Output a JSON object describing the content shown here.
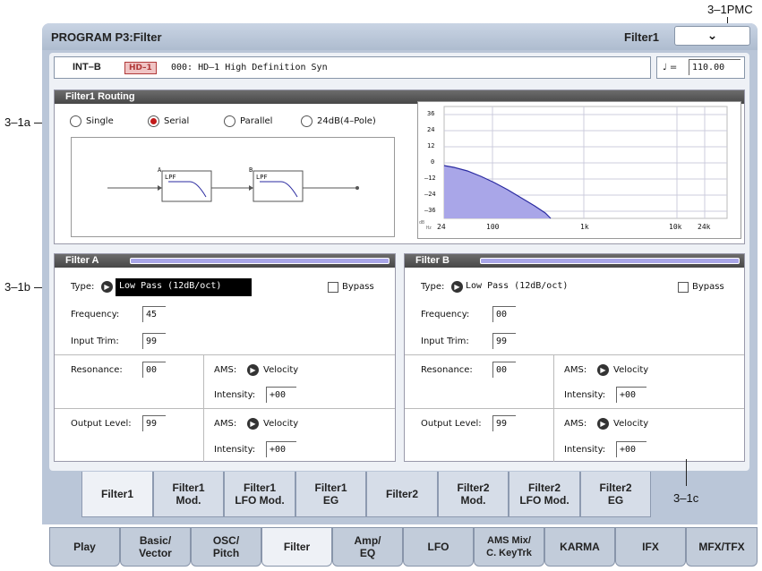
{
  "callouts": {
    "pmc": "3–1PMC",
    "a": "3–1a",
    "b": "3–1b",
    "c": "3–1c"
  },
  "header": {
    "title": "PROGRAM P3:Filter",
    "page_label": "Filter1",
    "menu_icon": "chevron-down"
  },
  "program": {
    "bank": "INT–B",
    "badge": "HD–1",
    "name": "000: HD–1 High Definition Syn"
  },
  "tempo": {
    "symbol": "♩ =",
    "value": "110.00"
  },
  "routing": {
    "title": "Filter1 Routing",
    "options": [
      "Single",
      "Serial",
      "Parallel",
      "24dB(4–Pole)"
    ],
    "selected": "Serial",
    "diagram": {
      "a_label": "A",
      "b_label": "B",
      "a_type": "LPF",
      "b_type": "LPF"
    }
  },
  "graph": {
    "y_ticks": [
      "36",
      "24",
      "12",
      "0",
      "–12",
      "–24",
      "–36"
    ],
    "x_ticks": [
      "24",
      "100",
      "1k",
      "10k",
      "24k"
    ],
    "unit_db": "dB",
    "unit_hz": "Hz"
  },
  "filter_a": {
    "title": "Filter A",
    "type_label": "Type:",
    "type_value": "Low Pass   (12dB/oct)",
    "bypass": "Bypass",
    "frequency_label": "Frequency:",
    "frequency": "45",
    "input_trim_label": "Input Trim:",
    "input_trim": "99",
    "resonance_label": "Resonance:",
    "resonance": "00",
    "ams1_label": "AMS:",
    "ams1": "Velocity",
    "int1_label": "Intensity:",
    "int1": "+00",
    "output_label": "Output Level:",
    "output": "99",
    "ams2_label": "AMS:",
    "ams2": "Velocity",
    "int2_label": "Intensity:",
    "int2": "+00"
  },
  "filter_b": {
    "title": "Filter B",
    "type_label": "Type:",
    "type_value": "Low Pass   (12dB/oct)",
    "bypass": "Bypass",
    "frequency_label": "Frequency:",
    "frequency": "00",
    "input_trim_label": "Input Trim:",
    "input_trim": "99",
    "resonance_label": "Resonance:",
    "resonance": "00",
    "ams1_label": "AMS:",
    "ams1": "Velocity",
    "int1_label": "Intensity:",
    "int1": "+00",
    "output_label": "Output Level:",
    "output": "99",
    "ams2_label": "AMS:",
    "ams2": "Velocity",
    "int2_label": "Intensity:",
    "int2": "+00"
  },
  "subtabs": [
    {
      "l1": "Filter1",
      "l2": ""
    },
    {
      "l1": "Filter1",
      "l2": "Mod."
    },
    {
      "l1": "Filter1",
      "l2": "LFO Mod."
    },
    {
      "l1": "Filter1",
      "l2": "EG"
    },
    {
      "l1": "Filter2",
      "l2": ""
    },
    {
      "l1": "Filter2",
      "l2": "Mod."
    },
    {
      "l1": "Filter2",
      "l2": "LFO Mod."
    },
    {
      "l1": "Filter2",
      "l2": "EG"
    }
  ],
  "maintabs": [
    {
      "l1": "Play",
      "l2": ""
    },
    {
      "l1": "Basic/",
      "l2": "Vector"
    },
    {
      "l1": "OSC/",
      "l2": "Pitch"
    },
    {
      "l1": "Filter",
      "l2": ""
    },
    {
      "l1": "Amp/",
      "l2": "EQ"
    },
    {
      "l1": "LFO",
      "l2": ""
    },
    {
      "l1": "AMS Mix/",
      "l2": "C. KeyTrk"
    },
    {
      "l1": "KARMA",
      "l2": ""
    },
    {
      "l1": "IFX",
      "l2": ""
    },
    {
      "l1": "MFX/TFX",
      "l2": ""
    }
  ],
  "colors": {
    "accent": "#c21a1a",
    "curve_fill": "#a9a6e8",
    "curve_line": "#2a2aa0",
    "tab_bg": "#d6dde8",
    "selected_tab": "#eef1f6"
  }
}
